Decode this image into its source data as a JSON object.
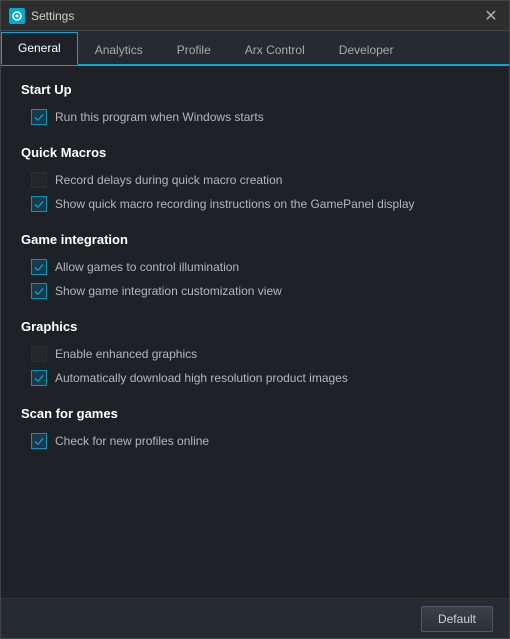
{
  "window": {
    "title": "Settings",
    "icon": "gear-icon"
  },
  "tabs": [
    {
      "id": "general",
      "label": "General",
      "active": true
    },
    {
      "id": "analytics",
      "label": "Analytics",
      "active": false
    },
    {
      "id": "profile",
      "label": "Profile",
      "active": false
    },
    {
      "id": "arx-control",
      "label": "Arx Control",
      "active": false
    },
    {
      "id": "developer",
      "label": "Developer",
      "active": false
    }
  ],
  "sections": [
    {
      "id": "startup",
      "title": "Start Up",
      "items": [
        {
          "id": "run-on-startup",
          "label": "Run this program when Windows starts",
          "checked": true,
          "disabled": false
        }
      ]
    },
    {
      "id": "quick-macros",
      "title": "Quick Macros",
      "items": [
        {
          "id": "record-delays",
          "label": "Record delays during quick macro creation",
          "checked": false,
          "disabled": true
        },
        {
          "id": "show-instructions",
          "label": "Show quick macro recording instructions on the GamePanel display",
          "checked": true,
          "disabled": false
        }
      ]
    },
    {
      "id": "game-integration",
      "title": "Game integration",
      "items": [
        {
          "id": "allow-illumination",
          "label": "Allow games to control illumination",
          "checked": true,
          "disabled": false
        },
        {
          "id": "show-customization",
          "label": "Show game integration customization view",
          "checked": true,
          "disabled": false
        }
      ]
    },
    {
      "id": "graphics",
      "title": "Graphics",
      "items": [
        {
          "id": "enhanced-graphics",
          "label": "Enable enhanced graphics",
          "checked": false,
          "disabled": true
        },
        {
          "id": "auto-download",
          "label": "Automatically download high resolution product images",
          "checked": true,
          "disabled": false
        }
      ]
    },
    {
      "id": "scan-games",
      "title": "Scan for games",
      "items": [
        {
          "id": "check-profiles",
          "label": "Check for new profiles online",
          "checked": true,
          "disabled": false
        }
      ]
    }
  ],
  "footer": {
    "default_label": "Default"
  }
}
